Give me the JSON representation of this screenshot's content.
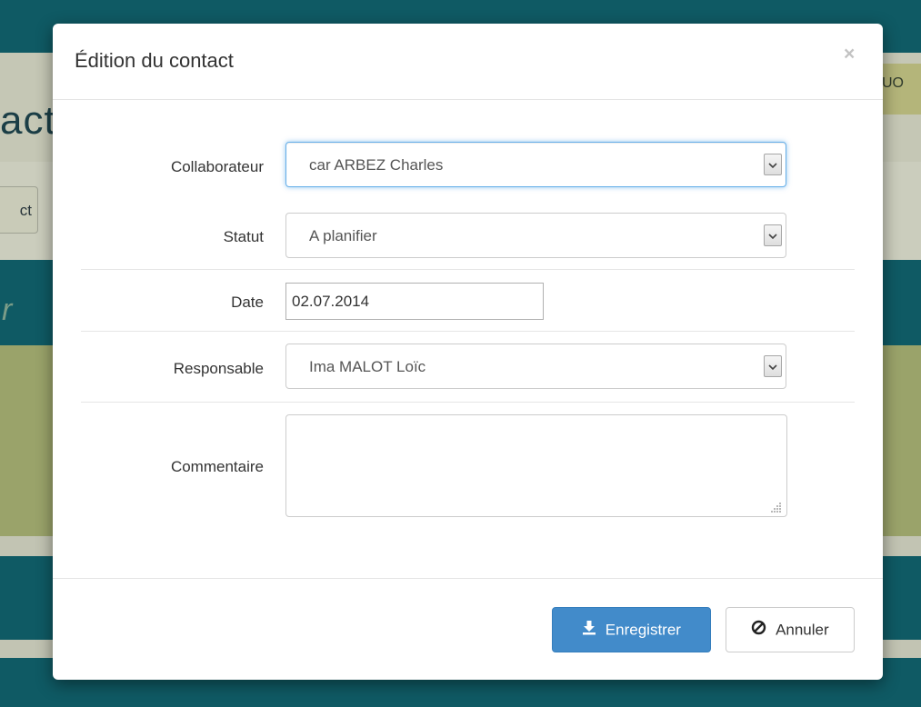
{
  "background": {
    "title_fragment": "act",
    "button_fragment": "ct",
    "tag_fragment": "UO",
    "teal_fragment": "r"
  },
  "modal": {
    "title": "Édition du contact",
    "close_glyph": "×",
    "fields": {
      "collaborateur": {
        "label": "Collaborateur",
        "value": "car ARBEZ Charles"
      },
      "statut": {
        "label": "Statut",
        "value": "A planifier"
      },
      "date": {
        "label": "Date",
        "value": "02.07.2014"
      },
      "responsable": {
        "label": "Responsable",
        "value": "Ima MALOT Loïc"
      },
      "commentaire": {
        "label": "Commentaire",
        "value": ""
      }
    },
    "footer": {
      "save_label": "Enregistrer",
      "save_icon": "download-icon",
      "cancel_label": "Annuler",
      "cancel_icon": "ban-icon"
    }
  },
  "colors": {
    "primary": "#428bca",
    "focus": "#66afe9",
    "backdrop": "#0f5a64",
    "olive": "#b4b57a"
  }
}
